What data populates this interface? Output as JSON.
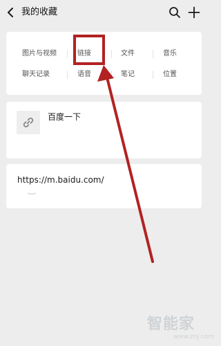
{
  "header": {
    "title": "我的收藏"
  },
  "categories": [
    {
      "label": "图片与视频"
    },
    {
      "label": "链接"
    },
    {
      "label": "文件"
    },
    {
      "label": "音乐"
    },
    {
      "label": "聊天记录"
    },
    {
      "label": "语音"
    },
    {
      "label": "笔记"
    },
    {
      "label": "位置"
    }
  ],
  "items": [
    {
      "type": "link",
      "title": "百度一下",
      "icon": "link-icon"
    },
    {
      "type": "url",
      "text": "https://m.baidu.com/"
    }
  ],
  "annotation": {
    "highlight_target": "链接",
    "color": "#b22222"
  },
  "watermark": {
    "text": "智能家",
    "url": "www.znj.com"
  },
  "colors": {
    "background": "#ededed",
    "card": "#ffffff",
    "annotation": "#b22222"
  }
}
